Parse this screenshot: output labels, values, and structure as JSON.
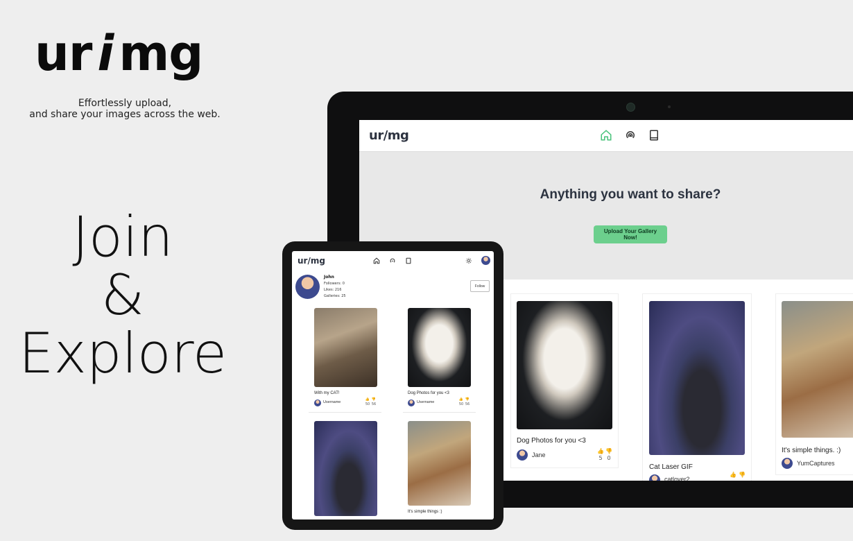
{
  "hero": {
    "brand_left": "ur",
    "brand_mid": "i",
    "brand_right": "mg",
    "tagline_line1": "Effortlessly upload,",
    "tagline_line2": "and  share your images across the web.",
    "headline_line1": "Join",
    "headline_line2": "&",
    "headline_line3": "Explore"
  },
  "laptop": {
    "logo": "ur/mg",
    "nav": [
      {
        "icon": "home-icon",
        "active": true
      },
      {
        "icon": "broadcast-icon",
        "active": false
      },
      {
        "icon": "book-icon",
        "active": false
      }
    ],
    "hero_title": "Anything you want to share?",
    "upload_button": "Upload Your Gallery Now!",
    "cards": [
      {
        "title": "Dog Photos for you <3",
        "user": "Jane",
        "likes": "5",
        "dislikes": "0",
        "photo": "dog"
      },
      {
        "title": "Cat Laser GIF",
        "user": "catlover2",
        "likes": "",
        "dislikes": "",
        "photo": "space-cat"
      },
      {
        "title": "It's simple things. :)",
        "user": "YumCaptures",
        "likes": "",
        "dislikes": "",
        "photo": "wrap"
      }
    ]
  },
  "tablet": {
    "logo": "ur/mg",
    "profile": {
      "name": "John",
      "followers": "Followers: 0",
      "likes": "Likes: 216",
      "galleries": "Galleries: 25"
    },
    "follow_button": "Follow",
    "cards": [
      {
        "title": "With my CAT!",
        "user": "Username",
        "likes": "50",
        "dislikes": "56",
        "photo": "cat"
      },
      {
        "title": "Dog Photos for you <3",
        "user": "Username",
        "likes": "50",
        "dislikes": "56",
        "photo": "dog"
      },
      {
        "title": "",
        "user": "",
        "photo": "space-cat"
      },
      {
        "title": "It's simple things :)",
        "user": "",
        "photo": "wrap"
      }
    ]
  },
  "colors": {
    "accent_green": "#6ccf8d",
    "bg": "#eeeeee",
    "device_frame": "#0f0f10"
  }
}
